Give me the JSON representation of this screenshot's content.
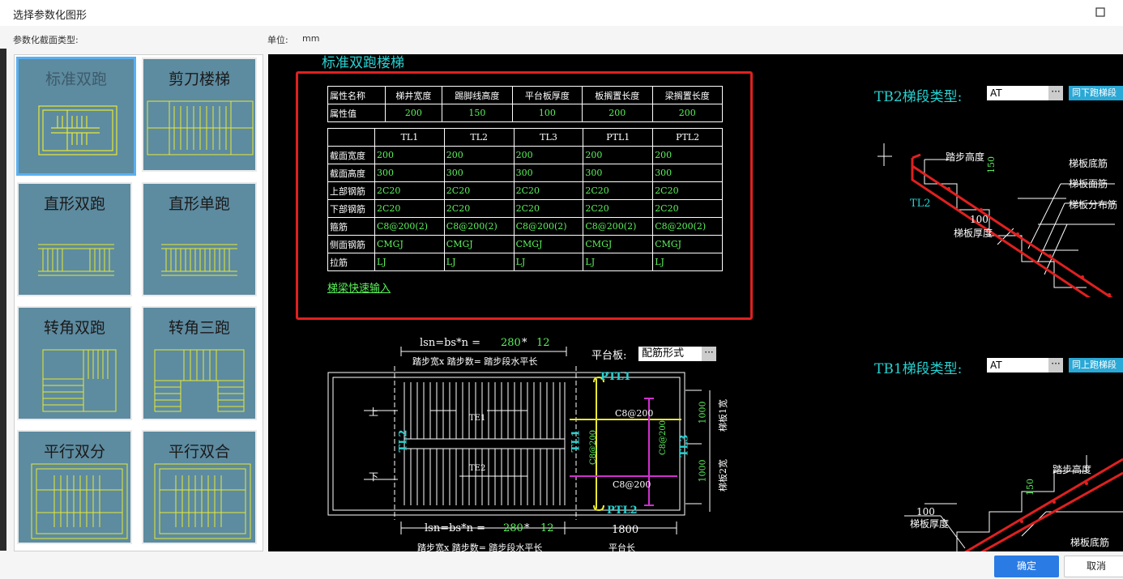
{
  "window": {
    "title": "选择参数化图形",
    "maximize_icon": "maximize-icon",
    "close_icon": "close-icon"
  },
  "header": {
    "section_type_label": "参数化截面类型:",
    "unit_label": "单位:",
    "unit_value": "mm"
  },
  "gallery": {
    "tiles": [
      {
        "label": "标准双跑",
        "selected": true
      },
      {
        "label": "剪刀楼梯"
      },
      {
        "label": "直形双跑"
      },
      {
        "label": "直形单跑"
      },
      {
        "label": "转角双跑"
      },
      {
        "label": "转角三跑"
      },
      {
        "label": "平行双分"
      },
      {
        "label": "平行双合"
      }
    ]
  },
  "canvas": {
    "title": "标准双跑楼梯",
    "props_table": {
      "headers": [
        "属性名称",
        "梯井宽度",
        "踢脚线高度",
        "平台板厚度",
        "板搁置长度",
        "梁搁置长度"
      ],
      "row_label": "属性值",
      "values": [
        "200",
        "150",
        "100",
        "200",
        "200"
      ]
    },
    "beam_table": {
      "headers": [
        "TL1",
        "TL2",
        "TL3",
        "PTL1",
        "PTL2"
      ],
      "rows": [
        {
          "label": "截面宽度",
          "values": [
            "200",
            "200",
            "200",
            "200",
            "200"
          ]
        },
        {
          "label": "截面高度",
          "values": [
            "300",
            "300",
            "300",
            "300",
            "300"
          ]
        },
        {
          "label": "上部钢筋",
          "values": [
            "2C20",
            "2C20",
            "2C20",
            "2C20",
            "2C20"
          ]
        },
        {
          "label": "下部钢筋",
          "values": [
            "2C20",
            "2C20",
            "2C20",
            "2C20",
            "2C20"
          ]
        },
        {
          "label": "箍筋",
          "values": [
            "C8@200(2)",
            "C8@200(2)",
            "C8@200(2)",
            "C8@200(2)",
            "C8@200(2)"
          ]
        },
        {
          "label": "侧面钢筋",
          "values": [
            "CMGJ",
            "CMGJ",
            "CMGJ",
            "CMGJ",
            "CMGJ"
          ]
        },
        {
          "label": "拉筋",
          "values": [
            "LJ",
            "LJ",
            "LJ",
            "LJ",
            "LJ"
          ]
        }
      ]
    },
    "quick_input_link": "梯梁快速输入",
    "tb2": {
      "label": "TB2梯段类型:",
      "value": "AT",
      "button": "同下跑梯段",
      "step_height": "踏步高度",
      "step_height_val": "150",
      "beam": "TL2",
      "thick_val": "100",
      "thick_label": "梯板厚度",
      "callouts": [
        "梯板底筋",
        "梯板面筋",
        "梯板分布筋"
      ]
    },
    "tb1": {
      "label": "TB1梯段类型:",
      "value": "AT",
      "button": "同上跑梯段",
      "step_height": "踏步高度",
      "step_height_val": "150",
      "thick_val": "100",
      "thick_label": "梯板厚度",
      "callout": "梯板底筋"
    },
    "plan": {
      "lsn_top_prefix": "lsn=bs*n = ",
      "lsn_top_bs": "280",
      "lsn_top_mult": " * ",
      "lsn_top_n": "12",
      "lsn_top_desc": "踏步宽x 踏步数= 踏步段水平长",
      "platform_label": "平台板:",
      "platform_value": "配筋形式",
      "up": "上",
      "down": "下",
      "te1": "TE1",
      "te2": "TE2",
      "tl1": "TL1",
      "tl2": "TL2",
      "tl3": "TL3",
      "ptl1": "PTL1",
      "ptl2": "PTL2",
      "c8_top": "C8@200",
      "c8_bot": "C8@200",
      "c8_v1": "C8@200",
      "c8_v2": "C8@200",
      "dim1": "1000",
      "dim2": "1000",
      "width1": "梯板1宽",
      "width2": "梯板2宽",
      "lsn_bot_prefix": "lsn=bs*n = ",
      "lsn_bot_bs": "280",
      "lsn_bot_mult": " * ",
      "lsn_bot_n": "12",
      "lsn_bot_desc": "踏步宽x 踏步数= 踏步段水平长",
      "platform_len": "1800",
      "platform_len_label": "平台长"
    }
  },
  "footer": {
    "ok": "确定",
    "cancel": "取消"
  },
  "colors": {
    "cyan": "#27d2d2",
    "green": "#5cf25c",
    "red": "#e02020",
    "yellow": "#e8e832",
    "magenta": "#d030d0",
    "tile_bg": "#5d8ba0",
    "ok_blue": "#2a7be4"
  }
}
